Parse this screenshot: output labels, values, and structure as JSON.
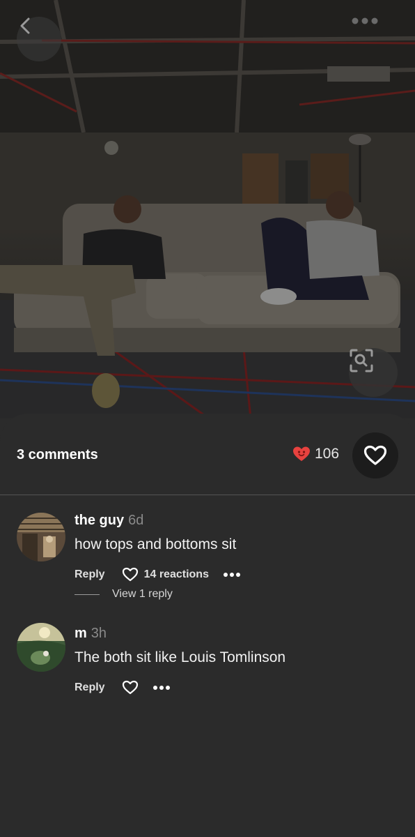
{
  "photo": {
    "back_icon": "chevron-left-icon",
    "more_icon": "more-horizontal-icon",
    "zoom_icon": "visual-search-icon"
  },
  "comments_header": {
    "count_label": "3 comments",
    "likes_count": "106",
    "likes_icon": "red-heart-emoji-icon",
    "like_button_icon": "heart-outline-icon",
    "accent_color": "#e8423f"
  },
  "comments": [
    {
      "author": "the guy",
      "time": "6d",
      "text": "how tops and bottoms sit",
      "reply_label": "Reply",
      "reactions_label": "14 reactions",
      "view_replies_label": "View 1 reply"
    },
    {
      "author": "m",
      "time": "3h",
      "text": "The both sit like Louis Tomlinson",
      "reply_label": "Reply"
    }
  ]
}
